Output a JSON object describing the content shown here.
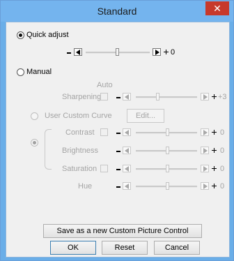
{
  "window": {
    "title": "Standard",
    "close_glyph": "✕"
  },
  "quick_adjust": {
    "label": "Quick adjust",
    "value": "0",
    "selected": true
  },
  "manual": {
    "label": "Manual",
    "selected": false,
    "auto_label": "Auto",
    "sharpening": {
      "label": "Sharpening",
      "value": "+3"
    },
    "user_custom_curve": {
      "label": "User Custom Curve",
      "edit_label": "Edit..."
    },
    "contrast": {
      "label": "Contrast",
      "value": "0"
    },
    "brightness": {
      "label": "Brightness",
      "value": "0"
    },
    "saturation": {
      "label": "Saturation",
      "value": "0"
    },
    "hue": {
      "label": "Hue",
      "value": "0"
    }
  },
  "buttons": {
    "save_as": "Save as a new Custom Picture Control",
    "ok": "OK",
    "reset": "Reset",
    "cancel": "Cancel"
  },
  "colors": {
    "titlebar": "#74b4ee",
    "close": "#c7392b",
    "client": "#f0f0f0",
    "disabled_text": "#a4a4a4"
  }
}
